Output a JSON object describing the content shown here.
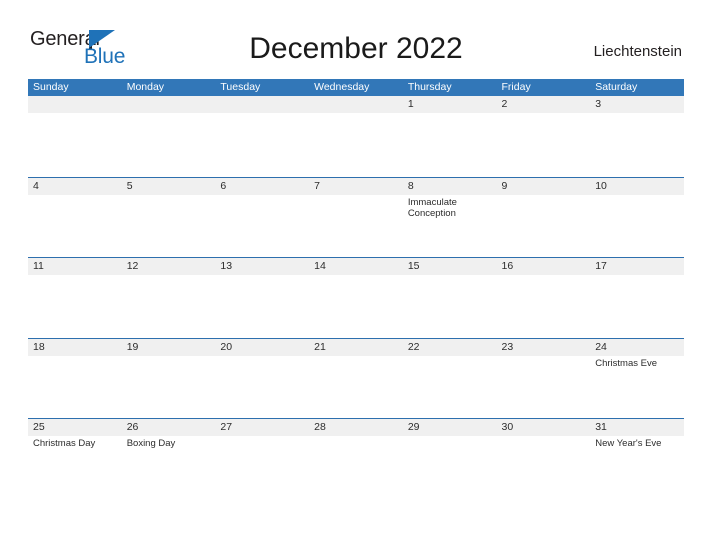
{
  "brand": {
    "name_part1": "General",
    "name_part2": "Blue",
    "triangle_color": "#1f72b8",
    "text_color": "#231f20"
  },
  "header": {
    "title": "December 2022",
    "country": "Liechtenstein"
  },
  "theme": {
    "header_blue": "#3277b8",
    "row_border_blue": "#2d6fae",
    "band_gray": "#f0f0f0",
    "text_dark": "#2c2c2c"
  },
  "calendar": {
    "day_headers": [
      "Sunday",
      "Monday",
      "Tuesday",
      "Wednesday",
      "Thursday",
      "Friday",
      "Saturday"
    ],
    "weeks": [
      [
        {
          "date": "",
          "events": []
        },
        {
          "date": "",
          "events": []
        },
        {
          "date": "",
          "events": []
        },
        {
          "date": "",
          "events": []
        },
        {
          "date": "1",
          "events": []
        },
        {
          "date": "2",
          "events": []
        },
        {
          "date": "3",
          "events": []
        }
      ],
      [
        {
          "date": "4",
          "events": []
        },
        {
          "date": "5",
          "events": []
        },
        {
          "date": "6",
          "events": []
        },
        {
          "date": "7",
          "events": []
        },
        {
          "date": "8",
          "events": [
            "Immaculate Conception"
          ]
        },
        {
          "date": "9",
          "events": []
        },
        {
          "date": "10",
          "events": []
        }
      ],
      [
        {
          "date": "11",
          "events": []
        },
        {
          "date": "12",
          "events": []
        },
        {
          "date": "13",
          "events": []
        },
        {
          "date": "14",
          "events": []
        },
        {
          "date": "15",
          "events": []
        },
        {
          "date": "16",
          "events": []
        },
        {
          "date": "17",
          "events": []
        }
      ],
      [
        {
          "date": "18",
          "events": []
        },
        {
          "date": "19",
          "events": []
        },
        {
          "date": "20",
          "events": []
        },
        {
          "date": "21",
          "events": []
        },
        {
          "date": "22",
          "events": []
        },
        {
          "date": "23",
          "events": []
        },
        {
          "date": "24",
          "events": [
            "Christmas Eve"
          ]
        }
      ],
      [
        {
          "date": "25",
          "events": [
            "Christmas Day"
          ]
        },
        {
          "date": "26",
          "events": [
            "Boxing Day"
          ]
        },
        {
          "date": "27",
          "events": []
        },
        {
          "date": "28",
          "events": []
        },
        {
          "date": "29",
          "events": []
        },
        {
          "date": "30",
          "events": []
        },
        {
          "date": "31",
          "events": [
            "New Year's Eve"
          ]
        }
      ]
    ]
  }
}
